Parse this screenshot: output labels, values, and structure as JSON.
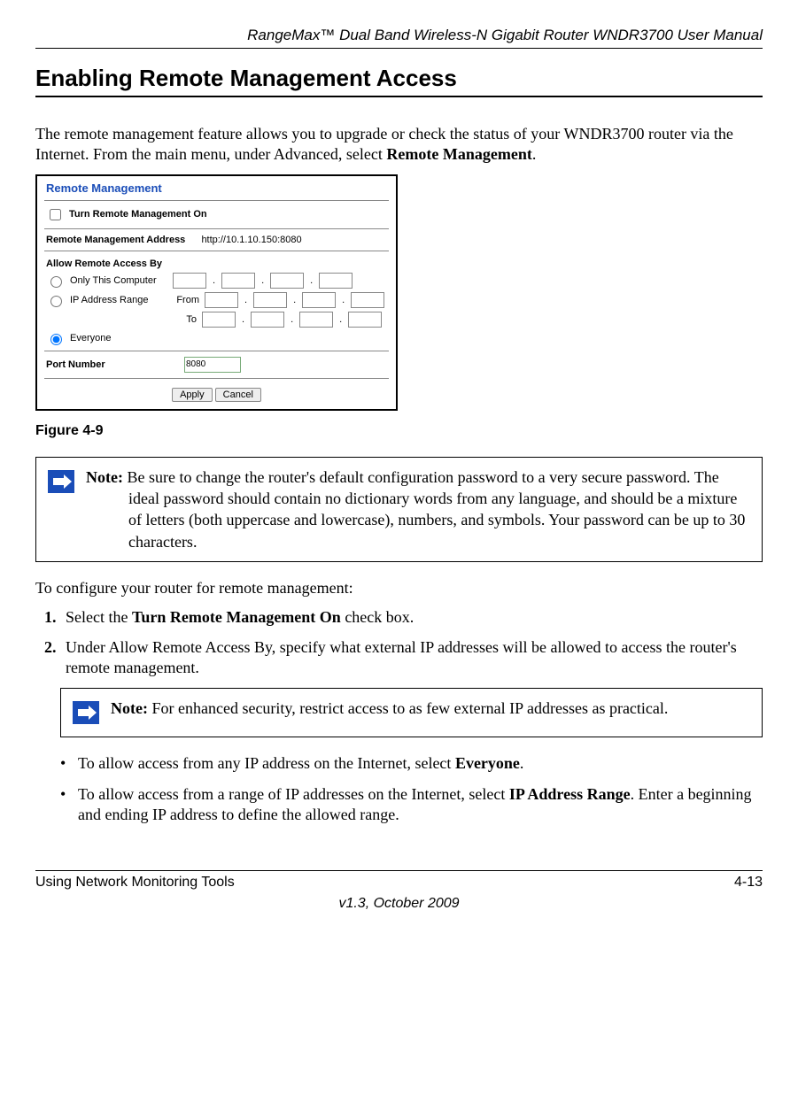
{
  "header": {
    "doc_title": "RangeMax™ Dual Band Wireless-N Gigabit Router WNDR3700 User Manual"
  },
  "section": {
    "title": "Enabling Remote Management Access",
    "intro_a": "The remote management feature allows you to upgrade or check the status of your WNDR3700 router via the Internet. From the main menu, under Advanced, select ",
    "intro_bold": "Remote Management",
    "intro_b": "."
  },
  "screenshot": {
    "panel_title": "Remote Management",
    "turn_on_label": "Turn Remote Management On",
    "addr_label": "Remote Management Address",
    "addr_value": "http://10.1.10.150:8080",
    "allow_section": "Allow Remote Access By",
    "only_this": "Only This Computer",
    "ip_range": "IP Address Range",
    "from": "From",
    "to": "To",
    "everyone": "Everyone",
    "port_label": "Port Number",
    "port_value": "8080",
    "apply": "Apply",
    "cancel": "Cancel"
  },
  "figure": {
    "caption": "Figure 4-9"
  },
  "note1": {
    "label": "Note: ",
    "text": "Be sure to change the router's default configuration password to a very secure password. The ideal password should contain no dictionary words from any language, and should be a mixture of letters (both uppercase and lowercase), numbers, and symbols. Your password can be up to 30 characters."
  },
  "config_intro": "To configure your router for remote management:",
  "steps": {
    "s1_a": "Select the ",
    "s1_bold": "Turn Remote Management On",
    "s1_b": " check box.",
    "s2": "Under Allow Remote Access By, specify what external IP addresses will be allowed to access the router's remote management."
  },
  "note2": {
    "label": "Note: ",
    "text": "For enhanced security, restrict access to as few external IP addresses as practical."
  },
  "bullets": {
    "b1_a": "To allow access from any IP address on the Internet, select ",
    "b1_bold": "Everyone",
    "b1_b": ".",
    "b2_a": "To allow access from a range of IP addresses on the Internet, select ",
    "b2_bold": "IP Address Range",
    "b2_b": ". Enter a beginning and ending IP address to define the allowed range."
  },
  "footer": {
    "left": "Using Network Monitoring Tools",
    "right": "4-13",
    "version": "v1.3, October 2009"
  }
}
